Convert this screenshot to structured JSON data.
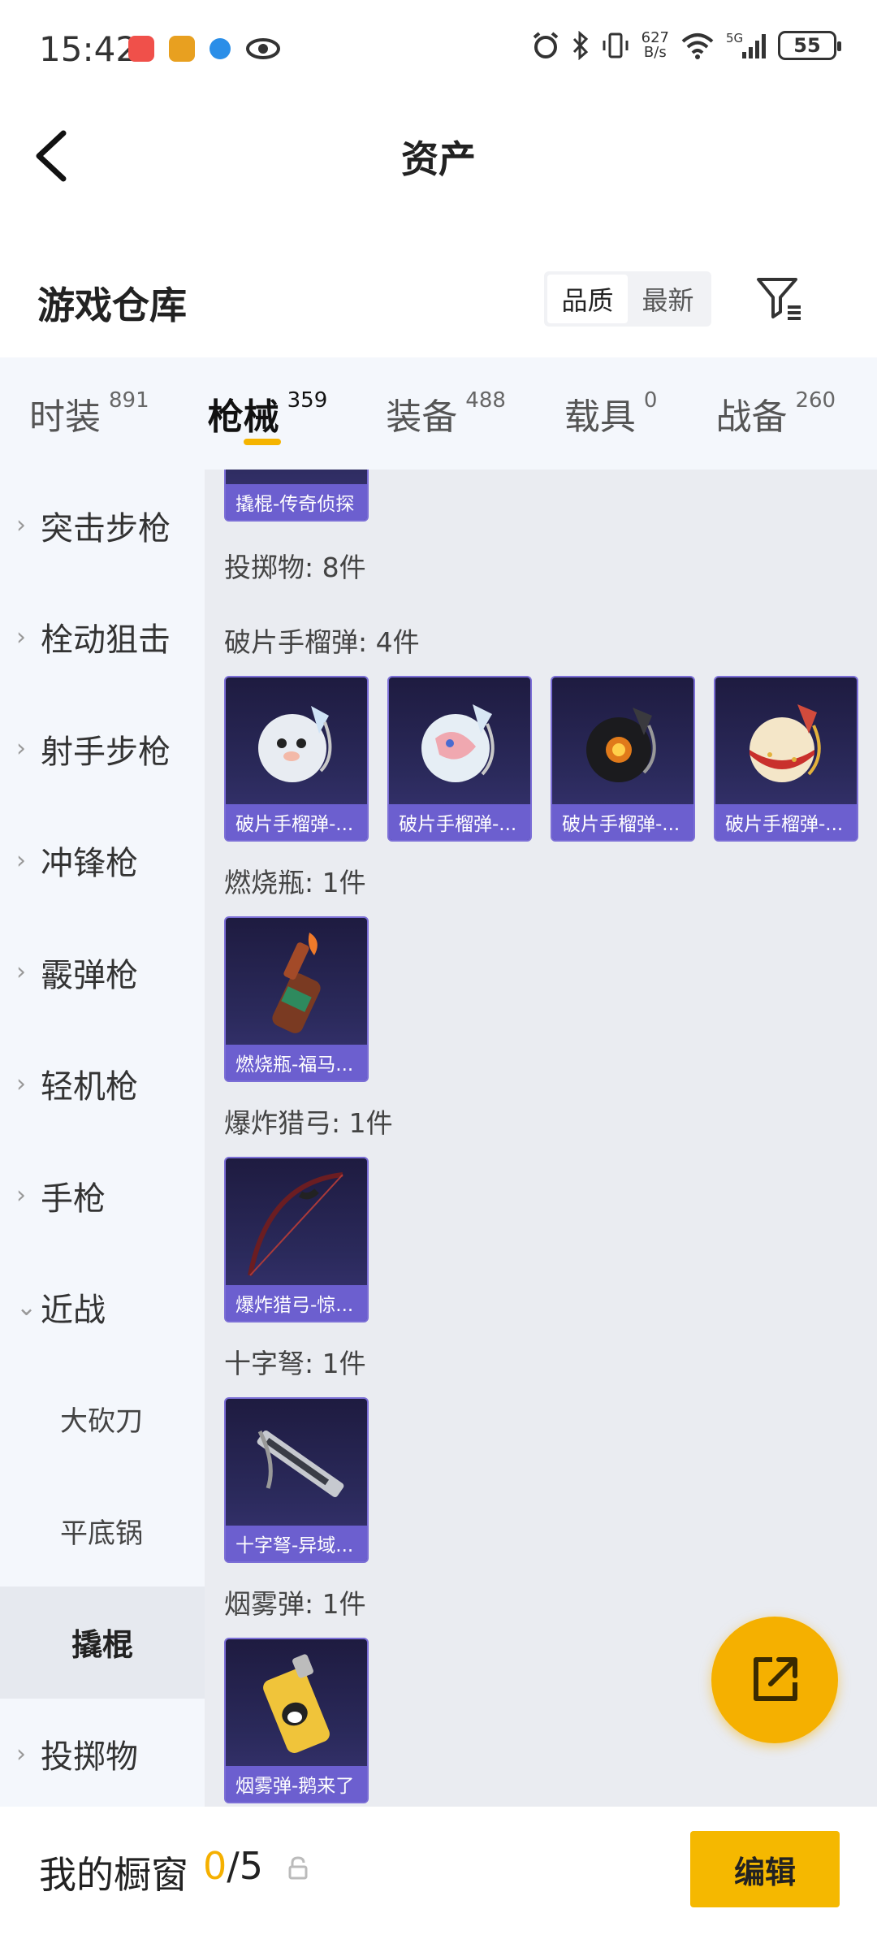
{
  "status": {
    "time": "15:42",
    "net_speed_top": "627",
    "net_speed_bottom": "B/s",
    "network": "5G",
    "battery": "55"
  },
  "header": {
    "title": "资产"
  },
  "warehouse": {
    "title": "游戏仓库",
    "sort_options": [
      "品质",
      "最新"
    ],
    "active_sort": "品质"
  },
  "tabs": [
    {
      "label": "时装",
      "count": "891"
    },
    {
      "label": "枪械",
      "count": "359",
      "active": true
    },
    {
      "label": "装备",
      "count": "488"
    },
    {
      "label": "载具",
      "count": "0"
    },
    {
      "label": "战备",
      "count": "260"
    }
  ],
  "sidebar": {
    "items": [
      {
        "label": "突击步枪"
      },
      {
        "label": "栓动狙击"
      },
      {
        "label": "射手步枪"
      },
      {
        "label": "冲锋枪"
      },
      {
        "label": "霰弹枪"
      },
      {
        "label": "轻机枪"
      },
      {
        "label": "手枪"
      },
      {
        "label": "近战"
      },
      {
        "label": "大砍刀"
      },
      {
        "label": "平底锅"
      },
      {
        "label": "撬棍"
      },
      {
        "label": "投掷物"
      }
    ]
  },
  "content": {
    "top_card_label": "撬棍-传奇侦探",
    "throwables_header": "投掷物: 8件",
    "frag_header": "破片手榴弹: 4件",
    "frag_cards": [
      "破片手榴弹-...",
      "破片手榴弹-...",
      "破片手榴弹-...",
      "破片手榴弹-..."
    ],
    "molotov_header": "燃烧瓶: 1件",
    "molotov_card": "燃烧瓶-福马...",
    "bow_header": "爆炸猎弓: 1件",
    "bow_card": "爆炸猎弓-惊...",
    "crossbow_header": "十字弩: 1件",
    "crossbow_card": "十字弩-异域...",
    "smoke_header": "烟雾弹: 1件",
    "smoke_card": "烟雾弹-鹅来了"
  },
  "bottom": {
    "title": "我的橱窗",
    "count_current": "0",
    "count_total": "/5",
    "edit_label": "编辑"
  },
  "colors": {
    "accent": "#f5b000",
    "card_label_bg": "#6c5fcf",
    "card_bg": "#2b2a5c"
  }
}
